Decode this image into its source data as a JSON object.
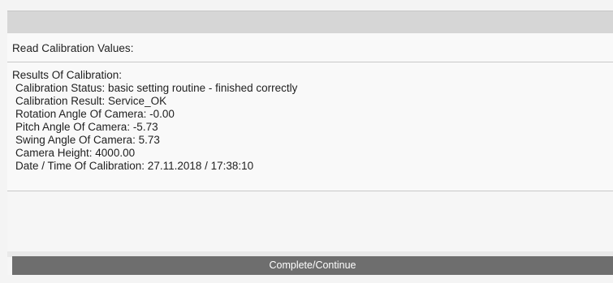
{
  "read_section": {
    "label": "Read Calibration Values:"
  },
  "results": {
    "title": "Results Of Calibration:",
    "lines": [
      "Calibration Status: basic setting routine - finished correctly",
      "Calibration Result: Service_OK",
      "Rotation Angle Of Camera: -0.00",
      "Pitch Angle Of Camera: -5.73",
      "Swing Angle Of Camera: 5.73",
      "Camera Height: 4000.00",
      "Date / Time Of Calibration: 27.11.2018 / 17:38:10"
    ]
  },
  "actions": {
    "complete_label": "Complete/Continue"
  }
}
